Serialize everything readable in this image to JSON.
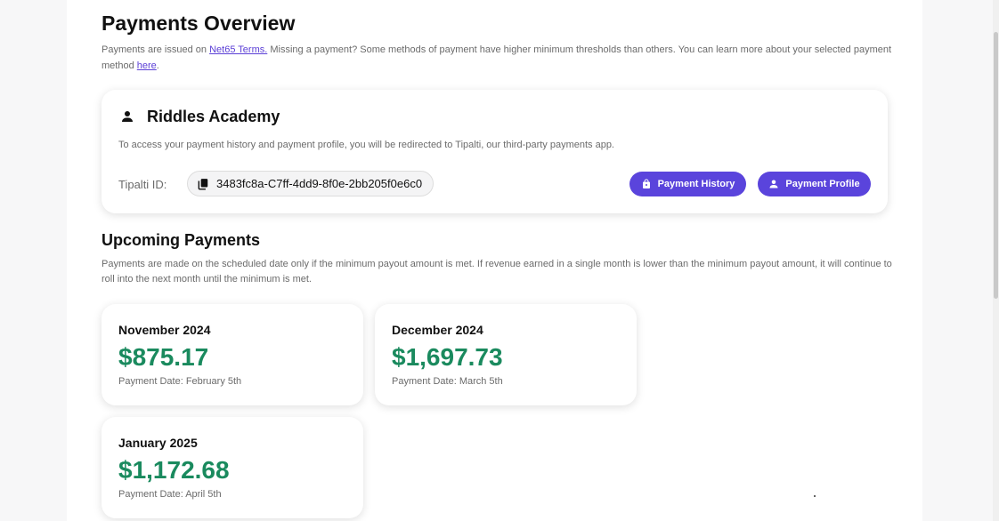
{
  "header": {
    "title": "Payments Overview",
    "intro_prefix": "Payments are issued on",
    "terms_link": "Net65 Terms.",
    "intro_middle": "Missing a payment? Some methods of payment have higher minimum thresholds than others. You can learn more about your selected payment method",
    "here_link": "here",
    "intro_suffix": "."
  },
  "account": {
    "name": "Riddles Academy",
    "description": "To access your payment history and payment profile, you will be redirected to Tipalti, our third-party payments app.",
    "tipalti_label": "Tipalti ID:",
    "tipalti_id": "3483fc8a-C7ff-4dd9-8f0e-2bb205f0e6c0",
    "history_button": "Payment History",
    "profile_button": "Payment Profile"
  },
  "upcoming": {
    "title": "Upcoming Payments",
    "description": "Payments are made on the scheduled date only if the minimum payout amount is met. If revenue earned in a single month is lower than the minimum payout amount, it will continue to roll into the next month until the minimum is met.",
    "payments": [
      {
        "month": "November 2024",
        "amount": "$875.17",
        "date": "Payment Date: February 5th"
      },
      {
        "month": "December 2024",
        "amount": "$1,697.73",
        "date": "Payment Date: March 5th"
      },
      {
        "month": "January 2025",
        "amount": "$1,172.68",
        "date": "Payment Date: April 5th"
      }
    ]
  },
  "colors": {
    "accent": "#5a44dc",
    "amount_green": "#1a8a5e",
    "link": "#5b3fd6"
  },
  "icons": {
    "account": "person-icon",
    "copy": "copy-icon",
    "history": "bag-icon",
    "profile": "person-icon"
  }
}
